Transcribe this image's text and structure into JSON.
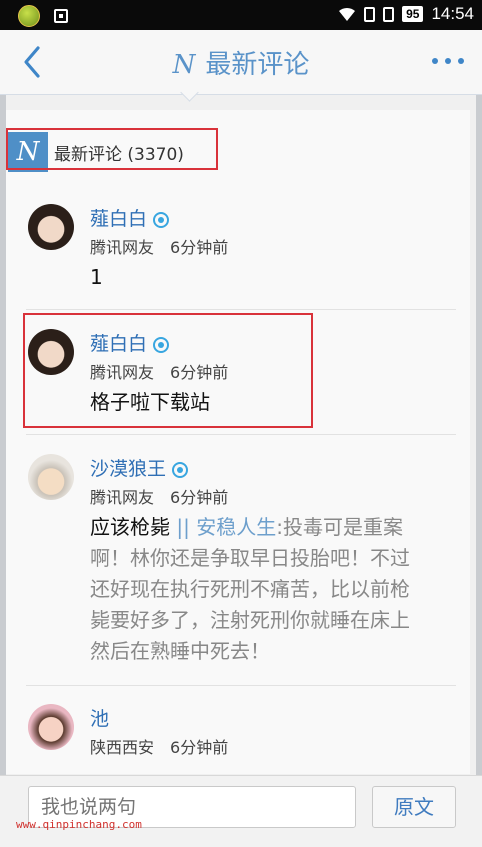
{
  "status_bar": {
    "battery": "95",
    "time": "14:54"
  },
  "nav": {
    "brand_letter": "N",
    "title": "最新评论"
  },
  "comments_header": {
    "badge_letter": "N",
    "label": "最新评论 (3370)"
  },
  "comments": [
    {
      "user": "薤白白",
      "source": "腾讯网友",
      "time": "6分钟前",
      "text": "1",
      "avatar": "girl-anime-avatar"
    },
    {
      "user": "薤白白",
      "source": "腾讯网友",
      "time": "6分钟前",
      "text": "格子啦下载站",
      "avatar": "girl-anime-avatar"
    },
    {
      "user": "沙漠狼王",
      "source": "腾讯网友",
      "time": "6分钟前",
      "text_lines": [
        "应该枪毙",
        "||",
        "安稳人生",
        ":",
        "投毒可是重案",
        "啊！林你还是争取早日投胎吧！不过",
        "还好现在执行死刑不痛苦，比以前枪",
        "毙要好多了，注射死刑你就睡在床上",
        "然后在熟睡中死去！"
      ],
      "avatar": "man-cartoon-avatar"
    },
    {
      "user": "池",
      "source": "陕西西安",
      "time": "6分钟前",
      "avatar": "baby-photo-avatar"
    }
  ],
  "composer": {
    "placeholder": "我也说两句",
    "original_button": "原文"
  },
  "watermark": "www.qinpinchang.com",
  "colors": {
    "accent": "#4f8fc7",
    "highlight_box": "#d9323a",
    "username": "#2f6fb5"
  }
}
